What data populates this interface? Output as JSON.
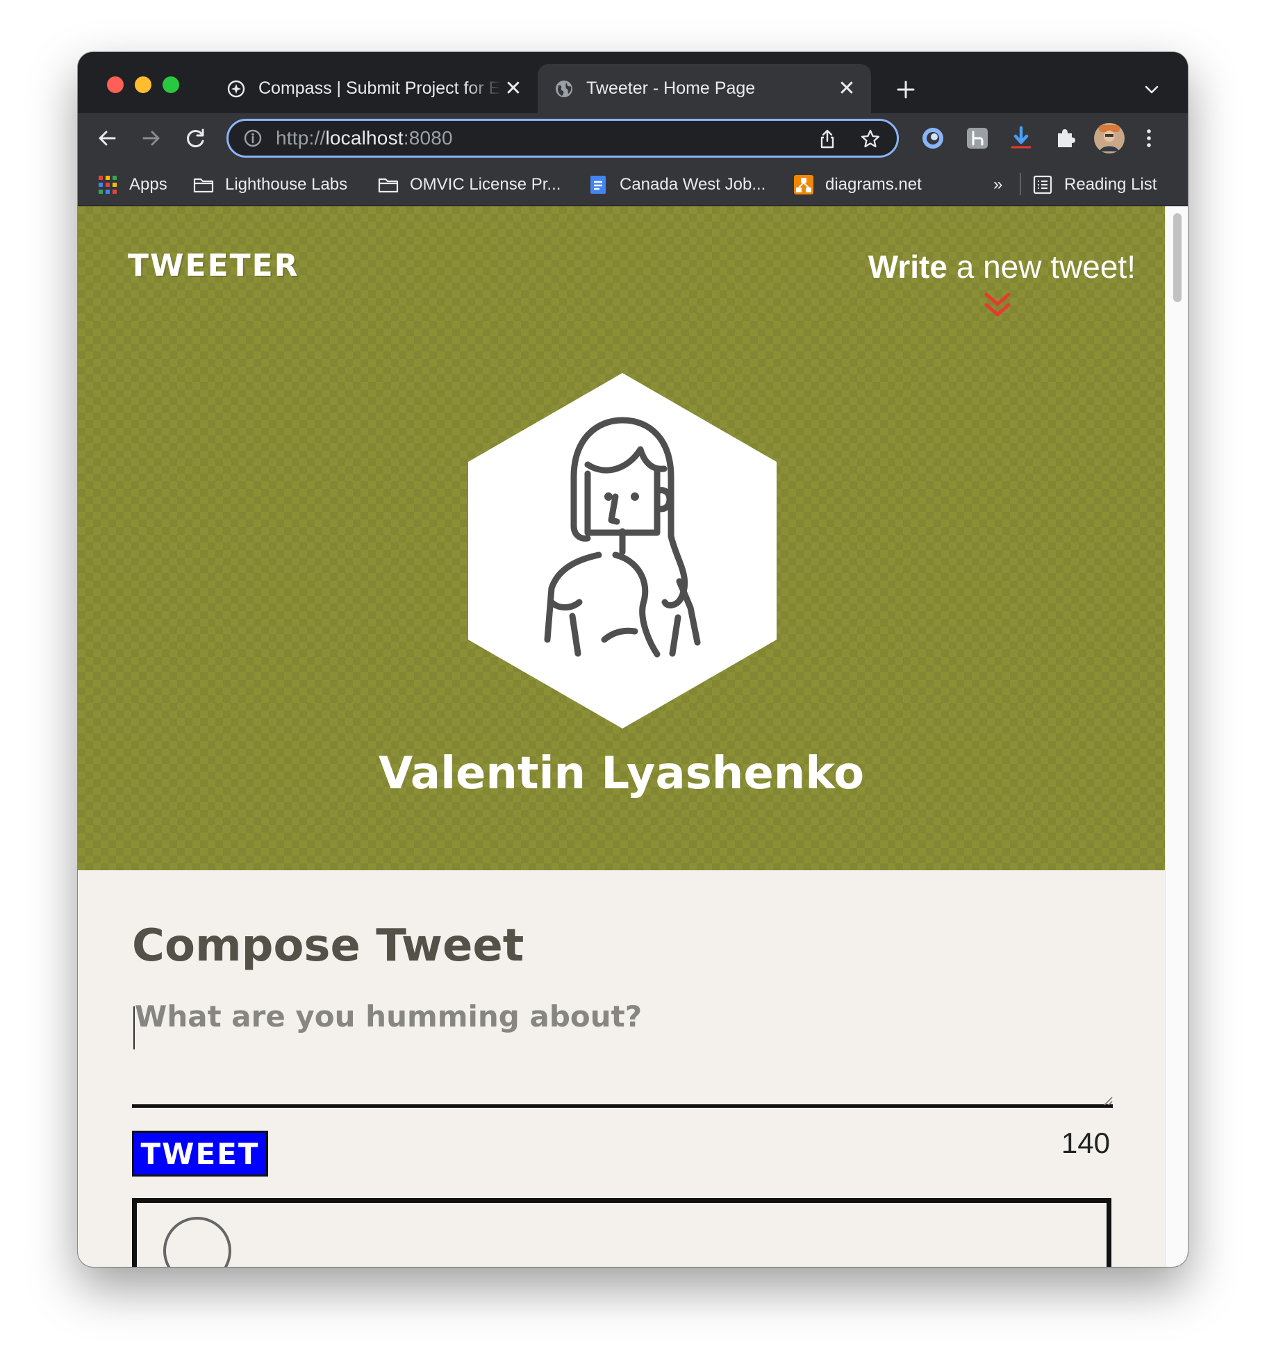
{
  "browser": {
    "tabs": [
      {
        "title": "Compass | Submit Project for Evaluation",
        "icon": "compass-icon",
        "active": false
      },
      {
        "title": "Tweeter - Home Page",
        "icon": "globe-icon",
        "active": true
      }
    ],
    "tab_close_glyph": "✕",
    "address_bar": {
      "scheme": "http://",
      "host": "localhost",
      "port": ":8080"
    },
    "bookmarks": [
      {
        "label": "Apps",
        "icon": "apps-grid-icon"
      },
      {
        "label": "Lighthouse Labs",
        "icon": "folder-icon"
      },
      {
        "label": "OMVIC License Pr...",
        "icon": "folder-icon"
      },
      {
        "label": "Canada West Job...",
        "icon": "docs-icon"
      },
      {
        "label": "diagrams.net",
        "icon": "diagrams-icon"
      }
    ],
    "bookmarks_overflow": "»",
    "reading_list": "Reading List"
  },
  "page": {
    "logo": "TWEETER",
    "nav": {
      "write_strong": "Write",
      "write_rest": " a new tweet!"
    },
    "profile": {
      "name": "Valentin Lyashenko"
    },
    "compose": {
      "title": "Compose Tweet",
      "placeholder": "What are you humming about?",
      "button": "TWEET",
      "counter": "140"
    }
  },
  "colors": {
    "hero_background": "#8b8f36",
    "accent_red": "#e53b2c",
    "tweet_button": "#0000ff",
    "page_background": "#f4f1ec",
    "heading": "#545149"
  }
}
